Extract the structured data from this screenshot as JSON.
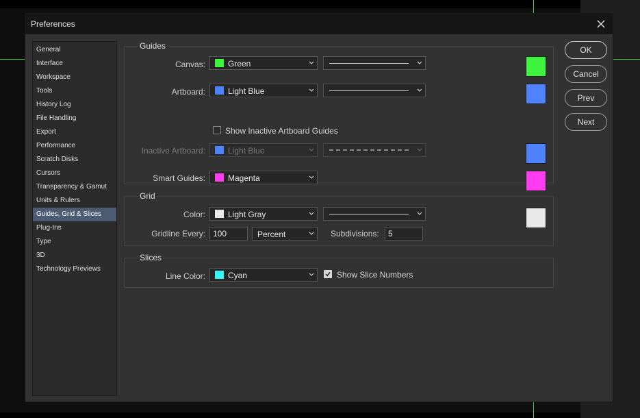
{
  "dialog": {
    "title": "Preferences"
  },
  "sidebar": {
    "items": [
      {
        "label": "General"
      },
      {
        "label": "Interface"
      },
      {
        "label": "Workspace"
      },
      {
        "label": "Tools"
      },
      {
        "label": "History Log"
      },
      {
        "label": "File Handling"
      },
      {
        "label": "Export"
      },
      {
        "label": "Performance"
      },
      {
        "label": "Scratch Disks"
      },
      {
        "label": "Cursors"
      },
      {
        "label": "Transparency & Gamut"
      },
      {
        "label": "Units & Rulers"
      },
      {
        "label": "Guides, Grid & Slices",
        "active": true
      },
      {
        "label": "Plug-Ins"
      },
      {
        "label": "Type"
      },
      {
        "label": "3D"
      },
      {
        "label": "Technology Previews"
      }
    ]
  },
  "guides": {
    "section_label": "Guides",
    "canvas": {
      "label": "Canvas:",
      "color_name": "Green",
      "swatch": "#3cf53c",
      "line_style": "solid"
    },
    "artboard": {
      "label": "Artboard:",
      "color_name": "Light Blue",
      "swatch": "#4f82ff",
      "line_style": "solid"
    },
    "show_inactive": {
      "label": "Show Inactive Artboard Guides",
      "checked": false
    },
    "inactive_artboard": {
      "label": "Inactive Artboard:",
      "color_name": "Light Blue",
      "swatch": "#4f82ff",
      "line_style": "dashed",
      "disabled": true
    },
    "smart_guides": {
      "label": "Smart Guides:",
      "color_name": "Magenta",
      "swatch": "#ff3cf0"
    }
  },
  "grid": {
    "section_label": "Grid",
    "color": {
      "label": "Color:",
      "color_name": "Light Gray",
      "swatch": "#e9e9e9",
      "line_style": "solid"
    },
    "gridline_every": {
      "label": "Gridline Every:",
      "value": "100",
      "unit": "Percent"
    },
    "subdivisions": {
      "label": "Subdivisions:",
      "value": "5"
    }
  },
  "slices": {
    "section_label": "Slices",
    "line_color": {
      "label": "Line Color:",
      "color_name": "Cyan",
      "swatch": "#33f5f5"
    },
    "show_numbers": {
      "label": "Show Slice Numbers",
      "checked": true
    }
  },
  "buttons": {
    "ok": "OK",
    "cancel": "Cancel",
    "prev": "Prev",
    "next": "Next"
  },
  "colors": {
    "accent_selected": "#4a5b72",
    "dialog_bg": "#323232",
    "canvas_guide": "#3fd24a"
  },
  "icons": {
    "close": "close-icon",
    "dropdown": "chevron-down-icon",
    "check": "checkmark-icon"
  }
}
